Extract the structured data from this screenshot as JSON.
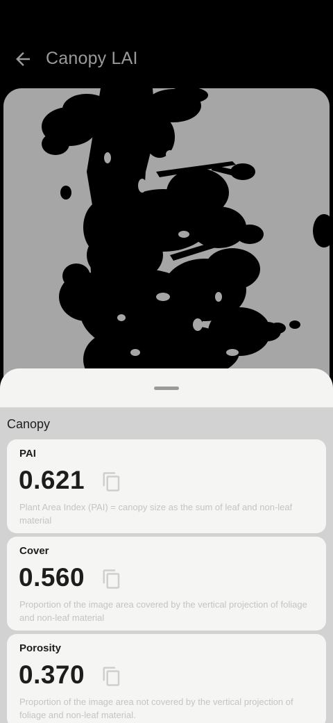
{
  "header": {
    "title": "Canopy LAI"
  },
  "image": {
    "sky_color": "#a6a6a6",
    "canopy_color": "#000000"
  },
  "sheet": {
    "section_title": "Canopy",
    "metrics": [
      {
        "label": "PAI",
        "value": "0.621",
        "description": "Plant Area Index (PAI) = canopy size as the sum of leaf and non-leaf material"
      },
      {
        "label": "Cover",
        "value": "0.560",
        "description": "Proportion of the image area covered by the vertical projection of foliage and non-leaf material"
      },
      {
        "label": "Porosity",
        "value": "0.370",
        "description": "Proportion of the image area not covered by the vertical projection of foliage and non-leaf material."
      }
    ]
  }
}
